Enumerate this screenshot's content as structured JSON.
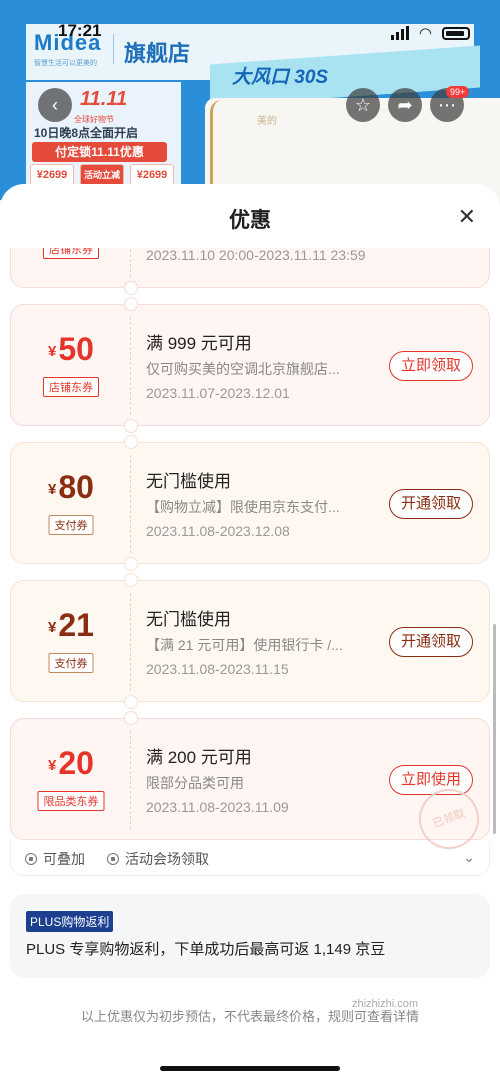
{
  "status_bar": {
    "time": "17:21"
  },
  "store_banner": {
    "brand": "Midea",
    "brand_sub": "智慧生活可以更美的",
    "store_name": "旗舰店",
    "promo_text": "大风口 30S",
    "ac_logo": "美的",
    "sale_title": "11.11",
    "sale_sub": "全球好物节",
    "sale_line1": "10日晚8点全面开启",
    "sale_line2": "付定锁11.11优惠",
    "chips": [
      "¥2699",
      "活动立减",
      "¥2699"
    ],
    "cart_badge": "99+"
  },
  "sheet": {
    "title": "优惠",
    "close_icon": "close-icon"
  },
  "coupons": [
    {
      "currency": "",
      "amount": "",
      "tag": "店铺东券",
      "title": "",
      "desc": "",
      "date": "2023.11.10 20:00-2023.11.11 23:59",
      "button": ""
    },
    {
      "currency": "¥",
      "amount": "50",
      "tag": "店铺东券",
      "title": "满 999 元可用",
      "desc": "仅可购买美的空调北京旗舰店...",
      "date": "2023.11.07-2023.12.01",
      "button": "立即领取"
    },
    {
      "currency": "¥",
      "amount": "80",
      "tag": "支付券",
      "title": "无门槛使用",
      "desc": "【购物立减】限使用京东支付...",
      "date": "2023.11.08-2023.12.08",
      "button": "开通领取"
    },
    {
      "currency": "¥",
      "amount": "21",
      "tag": "支付券",
      "title": "无门槛使用",
      "desc": "【满 21 元可用】使用银行卡 /...",
      "date": "2023.11.08-2023.11.15",
      "button": "开通领取"
    },
    {
      "currency": "¥",
      "amount": "20",
      "tag": "限品类东券",
      "title": "满 200 元可用",
      "desc": "限部分品类可用",
      "date": "2023.11.08-2023.11.09",
      "button": "立即使用",
      "stamp": "已领取"
    }
  ],
  "info_row": {
    "stackable": "可叠加",
    "venue": "活动会场领取"
  },
  "plus": {
    "tag": "PLUS购物返利",
    "text": "PLUS 专享购物返利，下单成功后最高可返 1,149 京豆"
  },
  "disclaimer": "以上优惠仅为初步预估，不代表最终价格，规则可查看详情",
  "watermark": "zhizhizhi.com",
  "colors": {
    "coupon_red": "#e5352b",
    "pay_brown": "#8a2d12",
    "plus_blue": "#1c3f8f"
  }
}
